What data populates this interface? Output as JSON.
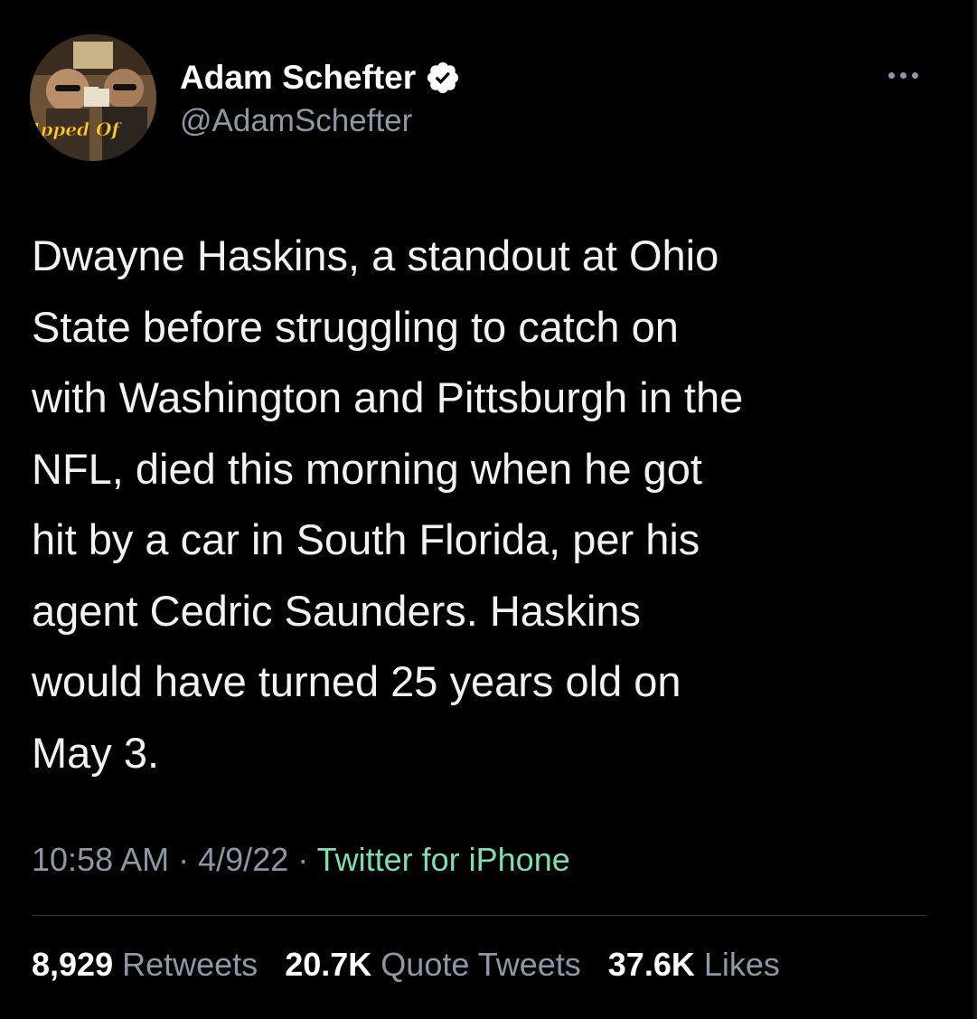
{
  "tweet": {
    "author": {
      "display_name": "Adam Schefter",
      "handle": "@AdamSchefter",
      "verified": true,
      "avatar_text": "lipped Of"
    },
    "text": "Dwayne Haskins, a standout at Ohio\nState before struggling to catch on\nwith Washington and Pittsburgh in the\nNFL, died this morning when he got\nhit by a car in South Florida, per his\nagent Cedric Saunders. Haskins\nwould have turned 25 years old on\nMay 3.",
    "time": "10:58 AM",
    "date": "4/9/22",
    "separator": "·",
    "source": "Twitter for iPhone",
    "stats": {
      "retweets_count": "8,929",
      "retweets_label": "Retweets",
      "quotes_count": "20.7K",
      "quotes_label": "Quote Tweets",
      "likes_count": "37.6K",
      "likes_label": "Likes"
    }
  },
  "icons": {
    "verified": "verified-badge-icon",
    "more": "more-options-icon"
  },
  "colors": {
    "background": "#000000",
    "text": "#e7e9ea",
    "secondary": "#8b98a5",
    "source_link": "#7cdfb0",
    "verified_badge": "#ffffff"
  }
}
